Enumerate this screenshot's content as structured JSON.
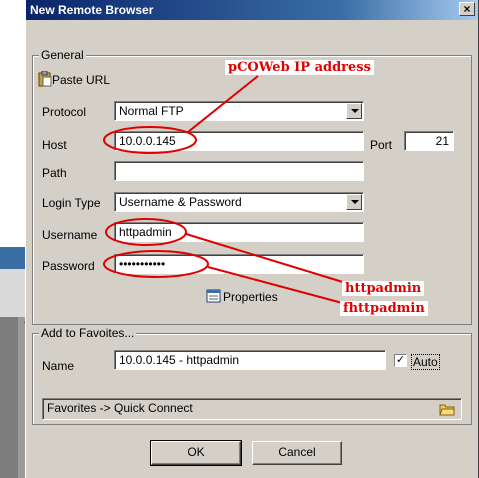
{
  "dialog": {
    "title": "New Remote Browser",
    "close_symbol": "×"
  },
  "general": {
    "legend": "General",
    "paste_url": "Paste URL",
    "protocol_label": "Protocol",
    "protocol_value": "Normal FTP",
    "host_label": "Host",
    "host_value": "10.0.0.145",
    "port_label": "Port",
    "port_value": "21",
    "path_label": "Path",
    "path_value": "",
    "login_type_label": "Login Type",
    "login_type_value": "Username & Password",
    "username_label": "Username",
    "username_value": "httpadmin",
    "password_label": "Password",
    "password_value": "•••••••••••",
    "properties_label": "Properties"
  },
  "favorites": {
    "legend": "Add to Favoites...",
    "name_label": "Name",
    "name_value": "10.0.0.145 - httpadmin",
    "auto_label": "Auto",
    "auto_checked": "✓",
    "quick_connect": "Favorites -> Quick Connect"
  },
  "buttons": {
    "ok": "OK",
    "cancel": "Cancel"
  },
  "annotations": {
    "ip": "pCOWeb IP address",
    "user": "httpadmin",
    "pass": "fhttpadmin"
  },
  "colors": {
    "annotation": "#e00000",
    "title_bar": "#0a246a",
    "dialog_bg": "#d4d0c8"
  }
}
